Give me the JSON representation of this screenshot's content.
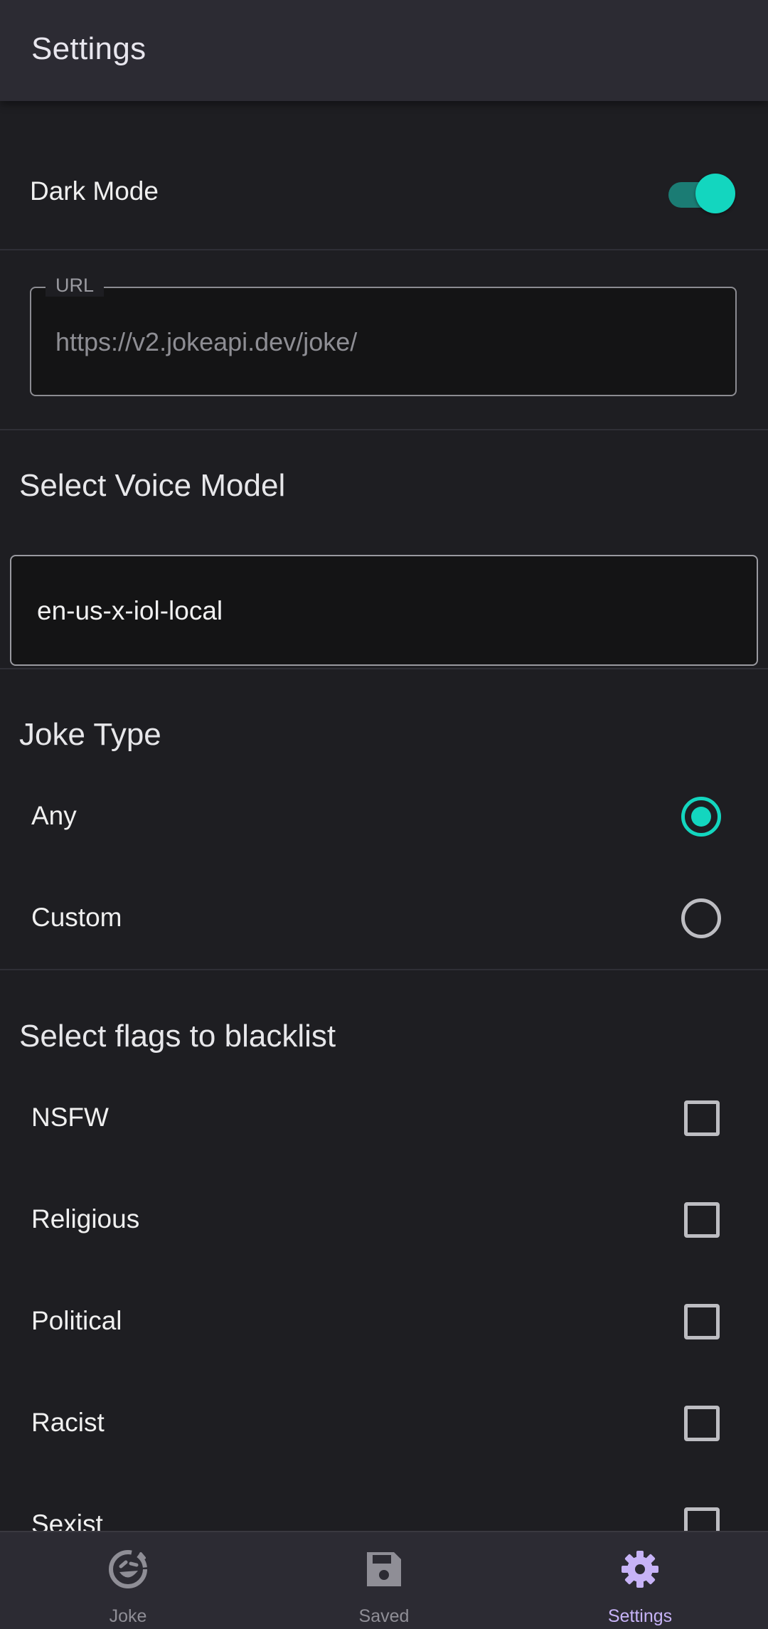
{
  "app_bar": {
    "title": "Settings"
  },
  "dark_mode": {
    "label": "Dark Mode",
    "enabled": true
  },
  "url_field": {
    "label": "URL",
    "placeholder": "https://v2.jokeapi.dev/joke/"
  },
  "voice": {
    "title": "Select Voice Model",
    "selected": "en-us-x-iol-local"
  },
  "joke_type": {
    "title": "Joke Type",
    "options": [
      {
        "label": "Any",
        "selected": true
      },
      {
        "label": "Custom",
        "selected": false
      }
    ]
  },
  "blacklist": {
    "title": "Select flags to blacklist",
    "flags": [
      {
        "label": "NSFW",
        "checked": false
      },
      {
        "label": "Religious",
        "checked": false
      },
      {
        "label": "Political",
        "checked": false
      },
      {
        "label": "Racist",
        "checked": false
      },
      {
        "label": "Sexist",
        "checked": false
      }
    ]
  },
  "bottom_nav": {
    "items": [
      {
        "label": "Joke",
        "icon": "laugh-icon",
        "active": false
      },
      {
        "label": "Saved",
        "icon": "save-icon",
        "active": false
      },
      {
        "label": "Settings",
        "icon": "gear-icon",
        "active": true
      }
    ]
  },
  "colors": {
    "accent": "#13d6bf",
    "nav_active": "#c7b3f7",
    "background": "#1e1e22",
    "app_bar": "#2c2b33"
  }
}
